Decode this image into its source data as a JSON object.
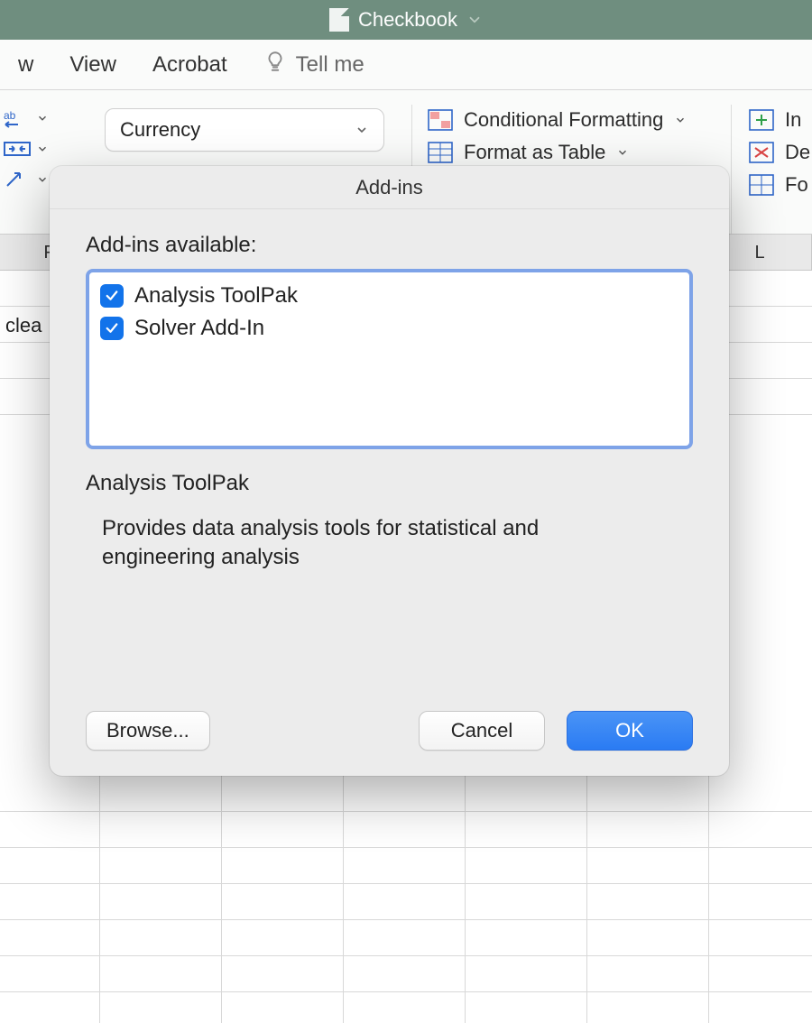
{
  "window": {
    "title": "Checkbook"
  },
  "ribbon": {
    "tabs": {
      "t0": "w",
      "t1": "View",
      "t2": "Acrobat",
      "tell_me": "Tell me"
    },
    "number_format": "Currency",
    "styles": {
      "conditional_formatting": "Conditional Formatting",
      "format_as_table": "Format as Table"
    },
    "cells": {
      "insert": "In",
      "delete": "De",
      "format": "Fo"
    }
  },
  "grid": {
    "col_headers": {
      "c0": "F",
      "c1": "L"
    },
    "cells": {
      "a1": "clea"
    }
  },
  "dialog": {
    "title": "Add-ins",
    "available_label": "Add-ins available:",
    "items": [
      {
        "label": "Analysis ToolPak",
        "checked": true
      },
      {
        "label": "Solver Add-In",
        "checked": true
      }
    ],
    "selected_name": "Analysis ToolPak",
    "selected_description": "Provides data analysis tools for statistical and engineering analysis",
    "buttons": {
      "browse": "Browse...",
      "cancel": "Cancel",
      "ok": "OK"
    }
  }
}
